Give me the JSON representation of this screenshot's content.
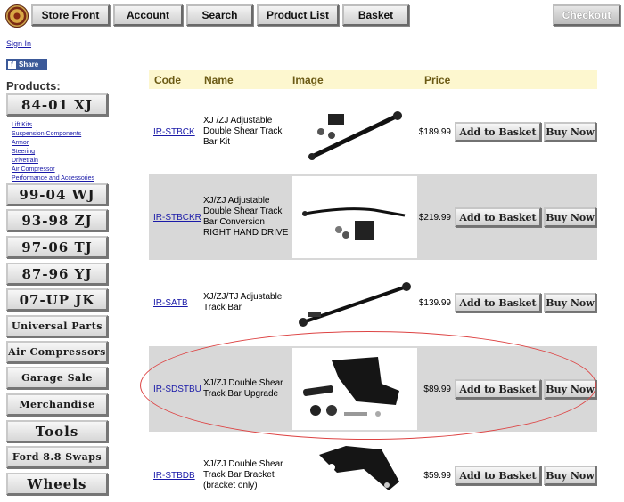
{
  "nav": {
    "store_front": "Store Front",
    "account": "Account",
    "search": "Search",
    "product_list": "Product List",
    "basket": "Basket",
    "checkout": "Checkout"
  },
  "sign_in": "Sign In",
  "share": "Share",
  "sidebar": {
    "title": "Products:",
    "main_item": "84-01 XJ",
    "sublinks": [
      "Lift Kits",
      "Suspension Components",
      "Armor",
      "Steering",
      "Drivetrain",
      "Air Compressor",
      "Performance and Accessories"
    ],
    "items": [
      "99-04 WJ",
      "93-98 ZJ",
      "97-06 TJ",
      "87-96 YJ",
      "07-UP JK",
      "Universal Parts",
      "Air Compressors",
      "Garage Sale",
      "Merchandise",
      "Tools",
      "Ford 8.8 Swaps",
      "Wheels"
    ]
  },
  "table": {
    "headers": {
      "code": "Code",
      "name": "Name",
      "image": "Image",
      "price": "Price"
    },
    "add_to_basket": "Add to Basket",
    "buy_now": "Buy Now",
    "rows": [
      {
        "code": "IR-STBCK",
        "name": "XJ /ZJ Adjustable Double Shear Track Bar Kit",
        "price": "$189.99"
      },
      {
        "code": "IR-STBCKR",
        "name": "XJ/ZJ Adjustable Double Shear Track Bar Conversion RIGHT HAND DRIVE",
        "price": "$219.99"
      },
      {
        "code": "IR-SATB",
        "name": "XJ/ZJ/TJ Adjustable Track Bar",
        "price": "$139.99"
      },
      {
        "code": "IR-SDSTBU",
        "name": "XJ/ZJ Double Shear Track Bar Upgrade",
        "price": "$89.99"
      },
      {
        "code": "IR-STBDB",
        "name": "XJ/ZJ Double Shear Track Bar Bracket (bracket only)",
        "price": "$59.99"
      }
    ]
  },
  "colors": {
    "header_bg": "#fdf7cf",
    "shaded_row": "#d8d8d8",
    "link": "#1a1aa8",
    "highlight_oval": "#dd4444"
  }
}
